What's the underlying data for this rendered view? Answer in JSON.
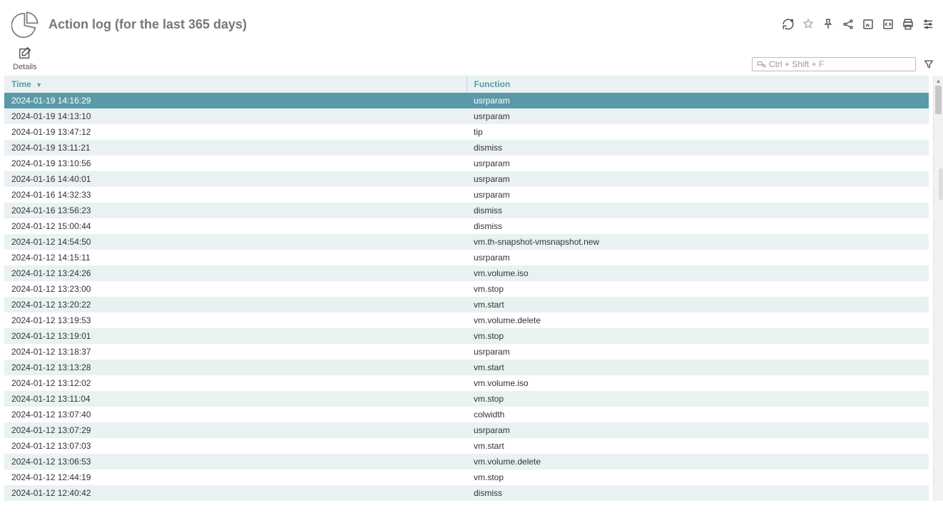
{
  "header": {
    "title": "Action log (for the last 365 days)"
  },
  "toolbar": {
    "details_label": "Details"
  },
  "search": {
    "placeholder": "Ctrl + Shift + F"
  },
  "table": {
    "col_time": "Time",
    "col_function": "Function",
    "rows": [
      {
        "time": "2024-01-19 14:16:29",
        "func": "usrparam"
      },
      {
        "time": "2024-01-19 14:13:10",
        "func": "usrparam"
      },
      {
        "time": "2024-01-19 13:47:12",
        "func": "tip"
      },
      {
        "time": "2024-01-19 13:11:21",
        "func": "dismiss"
      },
      {
        "time": "2024-01-19 13:10:56",
        "func": "usrparam"
      },
      {
        "time": "2024-01-16 14:40:01",
        "func": "usrparam"
      },
      {
        "time": "2024-01-16 14:32:33",
        "func": "usrparam"
      },
      {
        "time": "2024-01-16 13:56:23",
        "func": "dismiss"
      },
      {
        "time": "2024-01-12 15:00:44",
        "func": "dismiss"
      },
      {
        "time": "2024-01-12 14:54:50",
        "func": "vm.th-snapshot-vmsnapshot.new"
      },
      {
        "time": "2024-01-12 14:15:11",
        "func": "usrparam"
      },
      {
        "time": "2024-01-12 13:24:26",
        "func": "vm.volume.iso"
      },
      {
        "time": "2024-01-12 13:23:00",
        "func": "vm.stop"
      },
      {
        "time": "2024-01-12 13:20:22",
        "func": "vm.start"
      },
      {
        "time": "2024-01-12 13:19:53",
        "func": "vm.volume.delete"
      },
      {
        "time": "2024-01-12 13:19:01",
        "func": "vm.stop"
      },
      {
        "time": "2024-01-12 13:18:37",
        "func": "usrparam"
      },
      {
        "time": "2024-01-12 13:13:28",
        "func": "vm.start"
      },
      {
        "time": "2024-01-12 13:12:02",
        "func": "vm.volume.iso"
      },
      {
        "time": "2024-01-12 13:11:04",
        "func": "vm.stop"
      },
      {
        "time": "2024-01-12 13:07:40",
        "func": "colwidth"
      },
      {
        "time": "2024-01-12 13:07:29",
        "func": "usrparam"
      },
      {
        "time": "2024-01-12 13:07:03",
        "func": "vm.start"
      },
      {
        "time": "2024-01-12 13:06:53",
        "func": "vm.volume.delete"
      },
      {
        "time": "2024-01-12 12:44:19",
        "func": "vm.stop"
      },
      {
        "time": "2024-01-12 12:40:42",
        "func": "dismiss"
      }
    ]
  }
}
